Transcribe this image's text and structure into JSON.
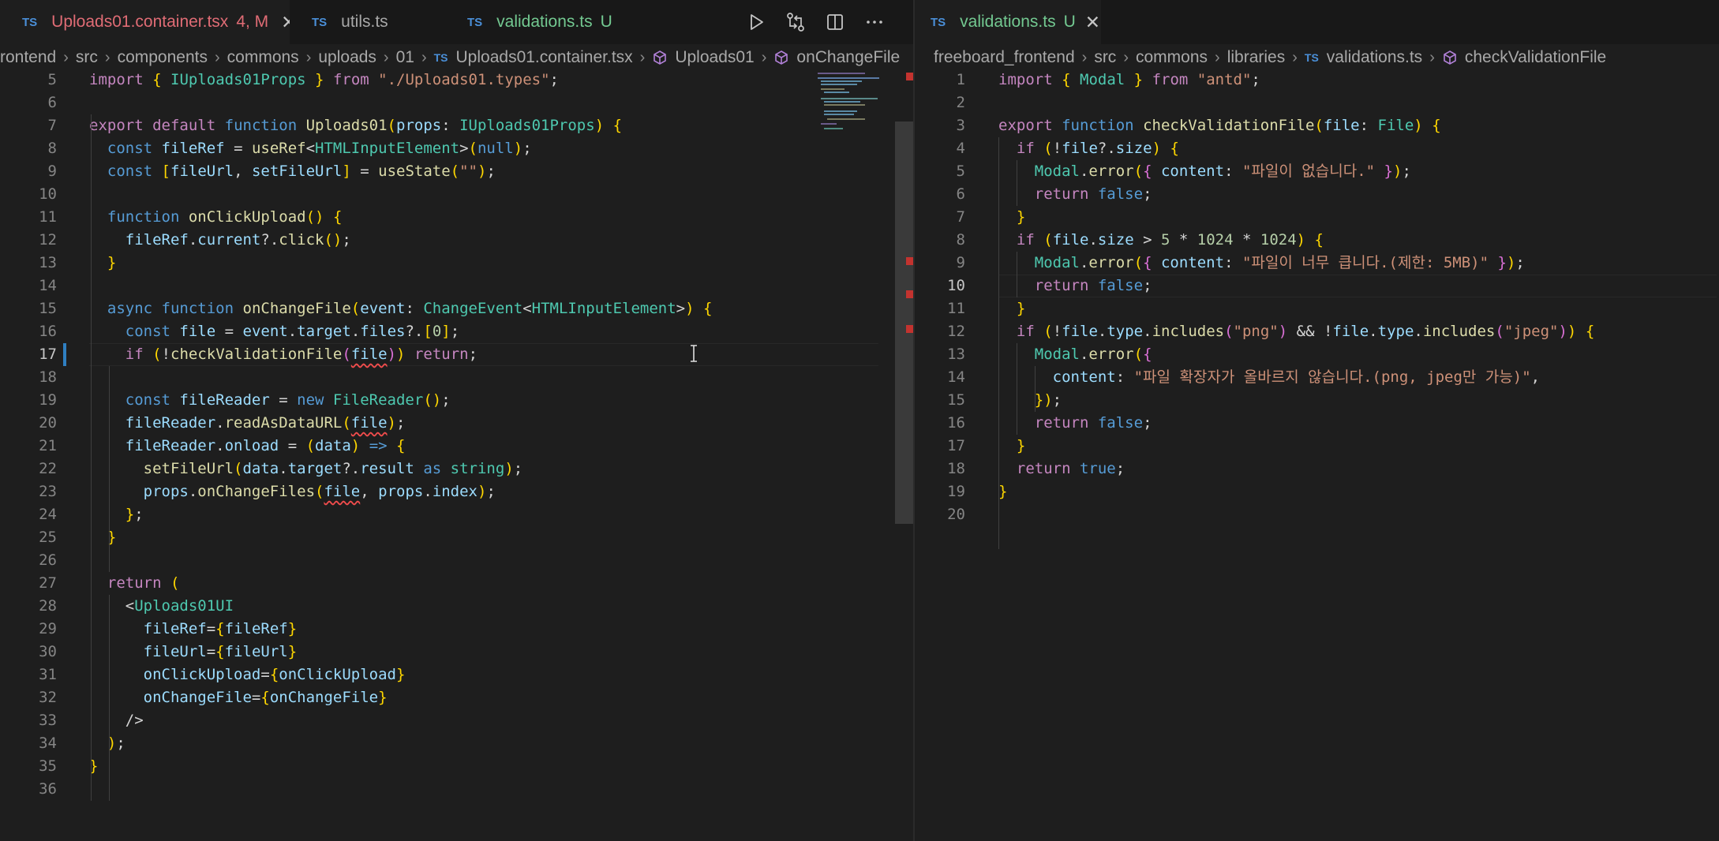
{
  "colors": {
    "editor_bg": "#1e1e1e",
    "tab_modified": "#e06c75",
    "tab_untracked": "#73c991",
    "ts_badge": "#4a8fd8",
    "accent": "#2f7fc1"
  },
  "left": {
    "tabs": [
      {
        "badge": "TS",
        "label": "Uploads01.container.tsx",
        "status": "4, M",
        "active": true
      },
      {
        "badge": "TS",
        "label": "utils.ts",
        "status": "",
        "active": false
      },
      {
        "badge": "TS",
        "label": "validations.ts",
        "status": "U",
        "active": false
      }
    ],
    "actions": [
      "run-icon",
      "source-control-compare-icon",
      "split-editor-icon",
      "more-actions-icon"
    ],
    "breadcrumb": {
      "folders": [
        "rontend",
        "src",
        "components",
        "commons",
        "uploads",
        "01"
      ],
      "file_badge": "TS",
      "file": "Uploads01.container.tsx",
      "symbols": [
        "Uploads01",
        "onChangeFile"
      ]
    },
    "current_line": 17,
    "lines": [
      {
        "n": 5,
        "t": "import { IUploads01Props } from \"./Uploads01.types\";"
      },
      {
        "n": 6,
        "t": ""
      },
      {
        "n": 7,
        "t": "export default function Uploads01(props: IUploads01Props) {"
      },
      {
        "n": 8,
        "t": "  const fileRef = useRef<HTMLInputElement>(null);"
      },
      {
        "n": 9,
        "t": "  const [fileUrl, setFileUrl] = useState(\"\");"
      },
      {
        "n": 10,
        "t": ""
      },
      {
        "n": 11,
        "t": "  function onClickUpload() {"
      },
      {
        "n": 12,
        "t": "    fileRef.current?.click();"
      },
      {
        "n": 13,
        "t": "  }"
      },
      {
        "n": 14,
        "t": ""
      },
      {
        "n": 15,
        "t": "  async function onChangeFile(event: ChangeEvent<HTMLInputElement>) {"
      },
      {
        "n": 16,
        "t": "    const file = event.target.files?.[0];"
      },
      {
        "n": 17,
        "t": "    if (!checkValidationFile(file)) return;"
      },
      {
        "n": 18,
        "t": ""
      },
      {
        "n": 19,
        "t": "    const fileReader = new FileReader();"
      },
      {
        "n": 20,
        "t": "    fileReader.readAsDataURL(file);"
      },
      {
        "n": 21,
        "t": "    fileReader.onload = (data) => {"
      },
      {
        "n": 22,
        "t": "      setFileUrl(data.target?.result as string);"
      },
      {
        "n": 23,
        "t": "      props.onChangeFiles(file, props.index);"
      },
      {
        "n": 24,
        "t": "    };"
      },
      {
        "n": 25,
        "t": "  }"
      },
      {
        "n": 26,
        "t": ""
      },
      {
        "n": 27,
        "t": "  return ("
      },
      {
        "n": 28,
        "t": "    <Uploads01UI"
      },
      {
        "n": 29,
        "t": "      fileRef={fileRef}"
      },
      {
        "n": 30,
        "t": "      fileUrl={fileUrl}"
      },
      {
        "n": 31,
        "t": "      onClickUpload={onClickUpload}"
      },
      {
        "n": 32,
        "t": "      onChangeFile={onChangeFile}"
      },
      {
        "n": 33,
        "t": "    />"
      },
      {
        "n": 34,
        "t": "  );"
      },
      {
        "n": 35,
        "t": "}"
      },
      {
        "n": 36,
        "t": ""
      }
    ]
  },
  "right": {
    "tabs": [
      {
        "badge": "TS",
        "label": "validations.ts",
        "status": "U",
        "active": true
      }
    ],
    "breadcrumb": {
      "folders": [
        "freeboard_frontend",
        "src",
        "commons",
        "libraries"
      ],
      "file_badge": "TS",
      "file": "validations.ts",
      "symbols": [
        "checkValidationFile"
      ]
    },
    "current_line": 10,
    "lines": [
      {
        "n": 1,
        "t": "import { Modal } from \"antd\";"
      },
      {
        "n": 2,
        "t": ""
      },
      {
        "n": 3,
        "t": "export function checkValidationFile(file: File) {"
      },
      {
        "n": 4,
        "t": "  if (!file?.size) {"
      },
      {
        "n": 5,
        "t": "    Modal.error({ content: \"파일이 없습니다.\" });"
      },
      {
        "n": 6,
        "t": "    return false;"
      },
      {
        "n": 7,
        "t": "  }"
      },
      {
        "n": 8,
        "t": "  if (file.size > 5 * 1024 * 1024) {"
      },
      {
        "n": 9,
        "t": "    Modal.error({ content: \"파일이 너무 큽니다.(제한: 5MB)\" });"
      },
      {
        "n": 10,
        "t": "    return false;"
      },
      {
        "n": 11,
        "t": "  }"
      },
      {
        "n": 12,
        "t": "  if (!file.type.includes(\"png\") && !file.type.includes(\"jpeg\")) {"
      },
      {
        "n": 13,
        "t": "    Modal.error({"
      },
      {
        "n": 14,
        "t": "      content: \"파일 확장자가 올바르지 않습니다.(png, jpeg만 가능)\","
      },
      {
        "n": 15,
        "t": "    });"
      },
      {
        "n": 16,
        "t": "    return false;"
      },
      {
        "n": 17,
        "t": "  }"
      },
      {
        "n": 18,
        "t": "  return true;"
      },
      {
        "n": 19,
        "t": "}"
      },
      {
        "n": 20,
        "t": ""
      }
    ]
  }
}
